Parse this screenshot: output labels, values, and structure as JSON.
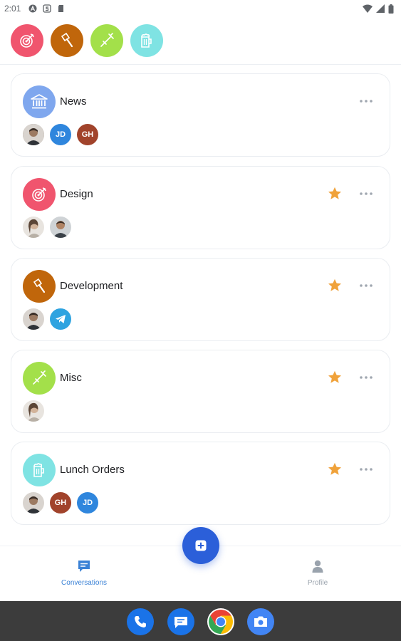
{
  "status_bar": {
    "time": "2:01"
  },
  "top_channels": [
    {
      "icon": "target-icon",
      "color": "#f0556e"
    },
    {
      "icon": "gavel-icon",
      "color": "#c0660b"
    },
    {
      "icon": "syringe-icon",
      "color": "#a3e04a"
    },
    {
      "icon": "beer-mug-icon",
      "color": "#7fe3e3"
    }
  ],
  "channels": [
    {
      "title": "News",
      "icon": "bank-icon",
      "color": "#7fa7ee",
      "starred": false,
      "members": [
        {
          "type": "photo"
        },
        {
          "type": "initials",
          "text": "JD",
          "color": "#2f86dd"
        },
        {
          "type": "initials",
          "text": "GH",
          "color": "#a1432b"
        }
      ]
    },
    {
      "title": "Design",
      "icon": "target-icon",
      "color": "#f0556e",
      "starred": true,
      "members": [
        {
          "type": "photo"
        },
        {
          "type": "photo"
        }
      ]
    },
    {
      "title": "Development",
      "icon": "gavel-icon",
      "color": "#c0660b",
      "starred": true,
      "members": [
        {
          "type": "photo"
        },
        {
          "type": "telegram"
        }
      ]
    },
    {
      "title": "Misc",
      "icon": "syringe-icon",
      "color": "#a3e04a",
      "starred": true,
      "members": [
        {
          "type": "photo"
        }
      ]
    },
    {
      "title": "Lunch Orders",
      "icon": "beer-mug-icon",
      "color": "#7fe3e3",
      "starred": true,
      "members": [
        {
          "type": "photo"
        },
        {
          "type": "initials",
          "text": "GH",
          "color": "#a1432b"
        },
        {
          "type": "initials",
          "text": "JD",
          "color": "#2f86dd"
        }
      ]
    }
  ],
  "bottom_nav": {
    "conversations_label": "Conversations",
    "profile_label": "Profile",
    "active_color": "#3b82d6",
    "inactive_color": "#9aa3ad"
  },
  "dock": [
    {
      "icon": "phone-icon",
      "color": "#1a73e8"
    },
    {
      "icon": "messages-icon",
      "color": "#1a73e8"
    },
    {
      "icon": "chrome-icon",
      "color": "#ffffff"
    },
    {
      "icon": "camera-icon",
      "color": "#4285f4"
    }
  ]
}
